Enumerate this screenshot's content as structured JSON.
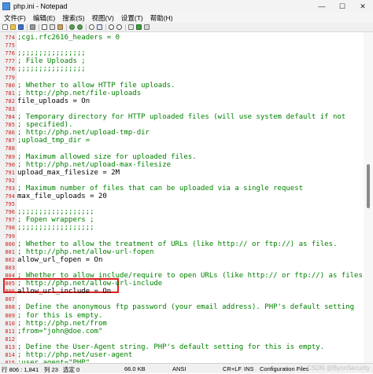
{
  "window": {
    "title": "php.ini - Notepad",
    "controls": [
      "—",
      "☐",
      "✕"
    ]
  },
  "menu": [
    "文件(F)",
    "编辑(E)",
    "搜索(S)",
    "视图(V)",
    "设置(T)",
    "帮助(H)"
  ],
  "toolbar": {
    "icons": [
      "new-icon",
      "open-icon",
      "save-icon",
      "print-icon",
      "cut-icon",
      "copy-icon",
      "paste-icon",
      "undo-icon",
      "redo-icon",
      "find-icon",
      "replace-icon",
      "zoom-in-icon",
      "zoom-out-icon",
      "wrap-icon",
      "spellcheck-icon",
      "settings-icon"
    ]
  },
  "editor": {
    "lines": [
      {
        "n": "774",
        "t": ";cgi.rfc2616_headers = 0",
        "type": "comment"
      },
      {
        "n": "775",
        "t": "",
        "type": "comment"
      },
      {
        "n": "776",
        "t": ";;;;;;;;;;;;;;;;",
        "type": "comment"
      },
      {
        "n": "777",
        "t": "; File Uploads ;",
        "type": "comment"
      },
      {
        "n": "778",
        "t": ";;;;;;;;;;;;;;;;",
        "type": "comment"
      },
      {
        "n": "779",
        "t": "",
        "type": "comment"
      },
      {
        "n": "780",
        "t": "; Whether to allow HTTP file uploads.",
        "type": "comment"
      },
      {
        "n": "781",
        "t": "; http://php.net/file-uploads",
        "type": "comment"
      },
      {
        "n": "782",
        "t": "file_uploads = On",
        "type": "directive"
      },
      {
        "n": "783",
        "t": "",
        "type": "comment"
      },
      {
        "n": "784",
        "t": "; Temporary directory for HTTP uploaded files (will use system default if not",
        "type": "comment"
      },
      {
        "n": "785",
        "t": "; specified).",
        "type": "comment"
      },
      {
        "n": "786",
        "t": "; http://php.net/upload-tmp-dir",
        "type": "comment"
      },
      {
        "n": "787",
        "t": ";upload_tmp_dir =",
        "type": "comment"
      },
      {
        "n": "788",
        "t": "",
        "type": "comment"
      },
      {
        "n": "789",
        "t": "; Maximum allowed size for uploaded files.",
        "type": "comment"
      },
      {
        "n": "790",
        "t": "; http://php.net/upload-max-filesize",
        "type": "comment"
      },
      {
        "n": "791",
        "t": "upload_max_filesize = 2M",
        "type": "directive"
      },
      {
        "n": "792",
        "t": "",
        "type": "comment"
      },
      {
        "n": "793",
        "t": "; Maximum number of files that can be uploaded via a single request",
        "type": "comment"
      },
      {
        "n": "794",
        "t": "max_file_uploads = 20",
        "type": "directive"
      },
      {
        "n": "795",
        "t": "",
        "type": "comment"
      },
      {
        "n": "796",
        "t": ";;;;;;;;;;;;;;;;;;",
        "type": "comment"
      },
      {
        "n": "797",
        "t": "; Fopen wrappers ;",
        "type": "comment"
      },
      {
        "n": "798",
        "t": ";;;;;;;;;;;;;;;;;;",
        "type": "comment"
      },
      {
        "n": "799",
        "t": "",
        "type": "comment"
      },
      {
        "n": "800",
        "t": "; Whether to allow the treatment of URLs (like http:// or ftp://) as files.",
        "type": "comment"
      },
      {
        "n": "801",
        "t": "; http://php.net/allow-url-fopen",
        "type": "comment"
      },
      {
        "n": "802",
        "t": "allow_url_fopen = On",
        "type": "directive"
      },
      {
        "n": "803",
        "t": "",
        "type": "comment"
      },
      {
        "n": "804",
        "t": "; Whether to allow include/require to open URLs (like http:// or ftp://) as files.",
        "type": "comment"
      },
      {
        "n": "805",
        "t": "; http://php.net/allow-url-include",
        "type": "comment"
      },
      {
        "n": "806",
        "t": "allow_url_include = On",
        "type": "directive"
      },
      {
        "n": "807",
        "t": "",
        "type": "comment"
      },
      {
        "n": "808",
        "t": "; Define the anonymous ftp password (your email address). PHP's default setting",
        "type": "comment"
      },
      {
        "n": "809",
        "t": "; for this is empty.",
        "type": "comment"
      },
      {
        "n": "810",
        "t": "; http://php.net/from",
        "type": "comment"
      },
      {
        "n": "811",
        "t": ";from=\"john@doe.com\"",
        "type": "comment"
      },
      {
        "n": "812",
        "t": "",
        "type": "comment"
      },
      {
        "n": "813",
        "t": "; Define the User-Agent string. PHP's default setting for this is empty.",
        "type": "comment"
      },
      {
        "n": "814",
        "t": "; http://php.net/user-agent",
        "type": "comment"
      },
      {
        "n": "815",
        "t": ";user_agent=\"PHP\"",
        "type": "comment"
      }
    ]
  },
  "statusbar": {
    "position": "行 806 : 1,841",
    "column": "列 23",
    "selection": "选定 0",
    "size": "66.0 KB",
    "encoding": "ANSI",
    "eol": "CR+LF",
    "mode": "INS",
    "lang": "Configuration Files",
    "watermark": "CSDN @BynnSecurity"
  },
  "colors": {
    "comment": "#008000",
    "line_numbers": "#cc2222",
    "highlight_box": "#e02020"
  }
}
